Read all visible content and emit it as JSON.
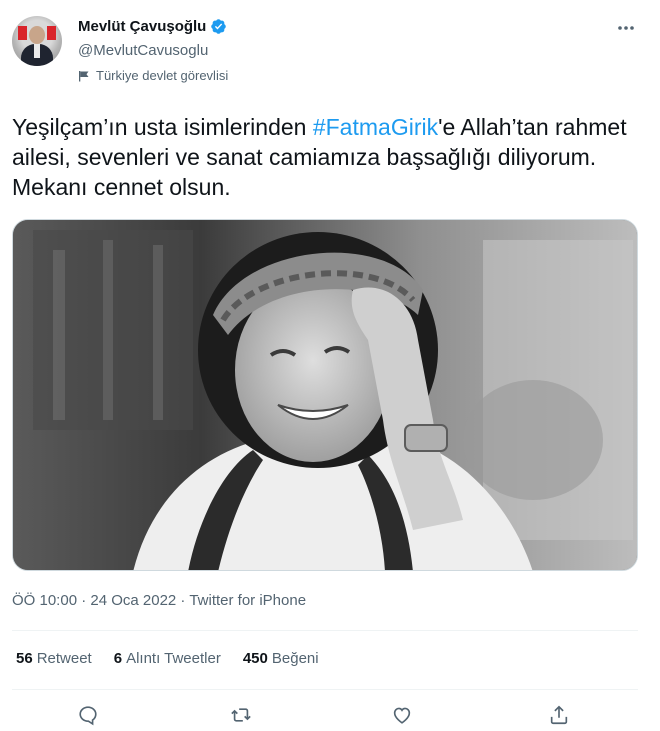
{
  "author": {
    "display_name": "Mevlüt Çavuşoğlu",
    "handle": "@MevlutCavusoglu",
    "label": "Türkiye devlet görevlisi"
  },
  "tweet": {
    "text_before": "Yeşilçam’ın usta isimlerinden ",
    "hashtag": "#FatmaGirik",
    "text_after": "'e Allah’tan rahmet ailesi, sevenleri ve sanat camiamıza başsağlığı diliyorum. Mekanı cennet olsun.",
    "timestamp": "ÖÖ 10:00 · 24 Oca 2022 · Twitter for iPhone"
  },
  "stats": {
    "retweets_count": "56",
    "retweets_label": "Retweet",
    "quotes_count": "6",
    "quotes_label": "Alıntı Tweetler",
    "likes_count": "450",
    "likes_label": "Beğeni"
  },
  "icons": {
    "verified": "verified-badge-icon",
    "label": "flag-icon",
    "more": "more-icon",
    "reply": "reply-icon",
    "retweet": "retweet-icon",
    "like": "heart-icon",
    "share": "share-icon"
  },
  "colors": {
    "accent": "#1d9bf0",
    "text": "#0f1419",
    "secondary": "#536471"
  }
}
